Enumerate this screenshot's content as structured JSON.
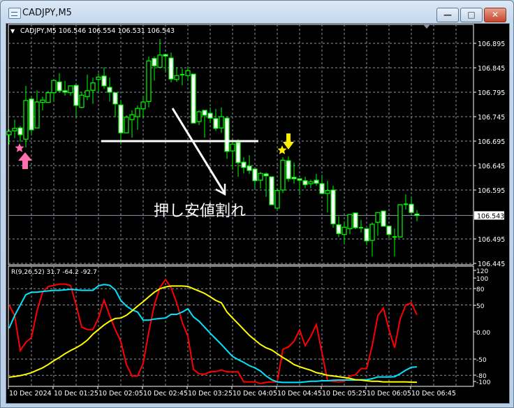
{
  "window": {
    "title": "CADJPY,M5",
    "buttons": {
      "minimize": "—",
      "maximize": "□",
      "close": "✕"
    }
  },
  "chart": {
    "header": "CADJPY,M5  106.546 106.554 106.531 106.543",
    "symbol": "CADJPY",
    "timeframe": "M5",
    "ohlc_current": {
      "open": 106.546,
      "high": 106.554,
      "low": 106.531,
      "close": 106.543
    },
    "price_ticks": [
      "106.895",
      "106.845",
      "106.795",
      "106.745",
      "106.695",
      "106.645",
      "106.595",
      "106.495",
      "106.445"
    ],
    "current_price_label": "106.543",
    "annotation_text": "押し安値割れ",
    "colors": {
      "background": "#000000",
      "grid": "#8a96a6",
      "candle_outline": "#00ff00",
      "bear_body": "#ffffff",
      "bull_body": "#000000",
      "annotation": "#ffffff",
      "buy_marker": "#ff6fb0",
      "sell_marker": "#ffee00"
    },
    "markers": [
      {
        "type": "buy",
        "icons": [
          "star-icon",
          "arrow-up-icon"
        ],
        "candle_time": "10 Dec 00:50"
      },
      {
        "type": "sell",
        "icons": [
          "star-icon",
          "arrow-down-icon"
        ],
        "candle_time": "10 Dec 04:50"
      }
    ]
  },
  "chart_data": [
    {
      "type": "candlestick",
      "title": "CADJPY,M5",
      "ylim": [
        106.445,
        106.915
      ],
      "grid": true,
      "candles_ohlc": [
        [
          106.708,
          106.719,
          106.688,
          106.715
        ],
        [
          106.716,
          106.739,
          106.701,
          106.721
        ],
        [
          106.722,
          106.726,
          106.694,
          106.708
        ],
        [
          106.699,
          106.808,
          106.682,
          106.778
        ],
        [
          106.781,
          106.788,
          106.708,
          106.718
        ],
        [
          106.722,
          106.799,
          106.722,
          106.775
        ],
        [
          106.774,
          106.786,
          106.758,
          106.779
        ],
        [
          106.774,
          106.798,
          106.774,
          106.794
        ],
        [
          106.794,
          106.819,
          106.776,
          106.819
        ],
        [
          106.816,
          106.834,
          106.795,
          106.798
        ],
        [
          106.798,
          106.818,
          106.788,
          106.795
        ],
        [
          106.794,
          106.808,
          106.788,
          106.808
        ],
        [
          106.809,
          106.809,
          106.744,
          106.768
        ],
        [
          106.764,
          106.796,
          106.762,
          106.789
        ],
        [
          106.786,
          106.831,
          106.779,
          106.798
        ],
        [
          106.799,
          106.825,
          106.771,
          106.814
        ],
        [
          106.821,
          106.834,
          106.794,
          106.826
        ],
        [
          106.828,
          106.846,
          106.802,
          106.808
        ],
        [
          106.805,
          106.825,
          106.776,
          106.795
        ],
        [
          106.794,
          106.794,
          106.744,
          106.771
        ],
        [
          106.769,
          106.779,
          106.688,
          106.712
        ],
        [
          106.712,
          106.748,
          106.712,
          106.744
        ],
        [
          106.739,
          106.758,
          106.702,
          106.749
        ],
        [
          106.745,
          106.768,
          106.718,
          106.762
        ],
        [
          106.761,
          106.788,
          106.742,
          106.775
        ],
        [
          106.776,
          106.868,
          106.764,
          106.859
        ],
        [
          106.864,
          106.868,
          106.819,
          106.849
        ],
        [
          106.846,
          106.904,
          106.845,
          106.871
        ],
        [
          106.872,
          106.872,
          106.836,
          106.869
        ],
        [
          106.865,
          106.876,
          106.815,
          106.822
        ],
        [
          106.821,
          106.846,
          106.816,
          106.829
        ],
        [
          106.831,
          106.844,
          106.809,
          106.831
        ],
        [
          106.829,
          106.846,
          106.819,
          106.839
        ],
        [
          106.832,
          106.832,
          106.731,
          106.732
        ],
        [
          106.735,
          106.758,
          106.728,
          106.755
        ],
        [
          106.758,
          106.758,
          106.702,
          106.748
        ],
        [
          106.752,
          106.764,
          106.732,
          106.742
        ],
        [
          106.741,
          106.761,
          106.716,
          106.721
        ],
        [
          106.722,
          106.764,
          106.712,
          106.745
        ],
        [
          106.742,
          106.744,
          106.659,
          106.674
        ],
        [
          106.675,
          106.698,
          106.636,
          106.689
        ],
        [
          106.692,
          106.699,
          106.622,
          106.651
        ],
        [
          106.652,
          106.662,
          106.629,
          106.641
        ],
        [
          106.644,
          106.666,
          106.628,
          106.635
        ],
        [
          106.638,
          106.638,
          106.598,
          106.614
        ],
        [
          106.615,
          106.632,
          106.598,
          106.629
        ],
        [
          106.628,
          106.631,
          106.581,
          106.624
        ],
        [
          106.622,
          106.622,
          106.565,
          106.565
        ],
        [
          106.558,
          106.598,
          106.555,
          106.594
        ],
        [
          106.595,
          106.662,
          106.589,
          106.656
        ],
        [
          106.655,
          106.664,
          106.612,
          106.618
        ],
        [
          106.621,
          106.651,
          106.608,
          106.618
        ],
        [
          106.618,
          106.618,
          106.585,
          106.615
        ],
        [
          106.614,
          106.622,
          106.599,
          106.606
        ],
        [
          106.608,
          106.616,
          106.599,
          106.612
        ],
        [
          106.615,
          106.628,
          106.604,
          106.609
        ],
        [
          106.608,
          106.626,
          106.588,
          106.588
        ],
        [
          106.588,
          106.614,
          106.549,
          106.594
        ],
        [
          106.595,
          106.604,
          106.518,
          106.526
        ],
        [
          106.524,
          106.541,
          106.499,
          106.506
        ],
        [
          106.504,
          106.531,
          106.485,
          106.519
        ],
        [
          106.516,
          106.546,
          106.505,
          106.545
        ],
        [
          106.548,
          106.548,
          106.515,
          106.518
        ],
        [
          106.518,
          106.534,
          106.508,
          106.518
        ],
        [
          106.516,
          106.516,
          106.482,
          106.491
        ],
        [
          106.492,
          106.529,
          106.459,
          106.525
        ],
        [
          106.529,
          106.549,
          106.501,
          106.549
        ],
        [
          106.552,
          106.552,
          106.521,
          106.521
        ],
        [
          106.521,
          106.521,
          106.494,
          106.504
        ],
        [
          106.499,
          106.516,
          106.459,
          106.499
        ],
        [
          106.499,
          106.566,
          106.499,
          106.565
        ],
        [
          106.564,
          106.586,
          106.555,
          106.566
        ],
        [
          106.566,
          106.579,
          106.549,
          106.549
        ],
        [
          106.546,
          106.554,
          106.531,
          106.543
        ]
      ],
      "horizontal_line_price": 106.695,
      "current_price": 106.543
    },
    {
      "type": "line",
      "title": "R(9,26,52) 31.7 -64.2 -92.7",
      "ylim": [
        -100,
        120
      ],
      "y_ticks": [
        "120",
        "100",
        "80",
        "50",
        "0.00",
        "-50",
        "-80",
        "-100"
      ],
      "gridlines": [
        80,
        50,
        -50,
        -80
      ],
      "x_tick_labels": [
        "10 Dec 2024",
        "10 Dec 01:25",
        "10 Dec 02:05",
        "10 Dec 02:45",
        "10 Dec 03:25",
        "10 Dec 04:05",
        "10 Dec 04:45",
        "10 Dec 05:25",
        "10 Dec 06:05",
        "10 Dec 06:45"
      ],
      "series": [
        {
          "color": "#ff0000",
          "values": [
            50,
            30.5,
            -34,
            -19,
            -10,
            39,
            73.5,
            84,
            86,
            88.6,
            88.6,
            86,
            50,
            9,
            4.7,
            4.7,
            26,
            59,
            30.5,
            4.7,
            -17,
            -60,
            -81,
            -81,
            -58,
            0,
            50,
            82,
            97,
            82,
            54,
            18,
            -8,
            -69,
            -77,
            -78,
            -73,
            -73,
            -70,
            -73.5,
            -73.5,
            -73.5,
            -92,
            -92,
            -92,
            -95,
            -93,
            -92,
            -92,
            -32,
            -27.5,
            -17,
            4,
            -25,
            -8,
            14,
            -38,
            -90,
            -91,
            -92,
            -91,
            -81,
            -79,
            -67.5,
            -67.5,
            -25,
            30.5,
            44,
            4.7,
            -29,
            24,
            50,
            54,
            31.7
          ]
        },
        {
          "color": "#00e5ff",
          "values": [
            7,
            30.5,
            50,
            69,
            73.5,
            73.5,
            75,
            76,
            77,
            77,
            78,
            79,
            78,
            77,
            77,
            77,
            85.6,
            87.7,
            86.5,
            78,
            58.5,
            48,
            41,
            37,
            22,
            22,
            24,
            25,
            26,
            32.7,
            32.7,
            37,
            43,
            28,
            20,
            9,
            -2,
            -12.5,
            -23,
            -34,
            -45,
            -51,
            -56,
            -62,
            -66,
            -72,
            -81,
            -88,
            -92,
            -93,
            -93,
            -93,
            -93,
            -92,
            -91,
            -91,
            -90,
            -90,
            -89,
            -88.6,
            -88.6,
            -88.6,
            -88.6,
            -88,
            -88,
            -86,
            -83,
            -83,
            -83,
            -82.6,
            -77,
            -70.5,
            -65,
            -64.2
          ]
        },
        {
          "color": "#ffff00",
          "values": [
            -83.4,
            -82,
            -80.4,
            -78,
            -75,
            -70.5,
            -66,
            -60,
            -53,
            -47,
            -40,
            -34,
            -29,
            -23,
            -15,
            -4,
            4.7,
            13,
            20,
            25,
            26,
            31,
            39,
            48,
            56,
            65,
            73.5,
            80,
            83.4,
            85,
            85,
            85,
            84.3,
            80,
            75.7,
            71.4,
            65,
            58.5,
            54,
            37,
            26,
            15.5,
            4.7,
            -6,
            -14.6,
            -23,
            -29,
            -33,
            -40,
            -47,
            -53,
            -60,
            -64,
            -67.5,
            -70.5,
            -75,
            -77,
            -80,
            -81,
            -82.6,
            -84,
            -85.6,
            -88,
            -88.6,
            -90,
            -91,
            -91,
            -92,
            -92,
            -92,
            -92,
            -92,
            -92.5,
            -92.7
          ]
        }
      ]
    }
  ]
}
